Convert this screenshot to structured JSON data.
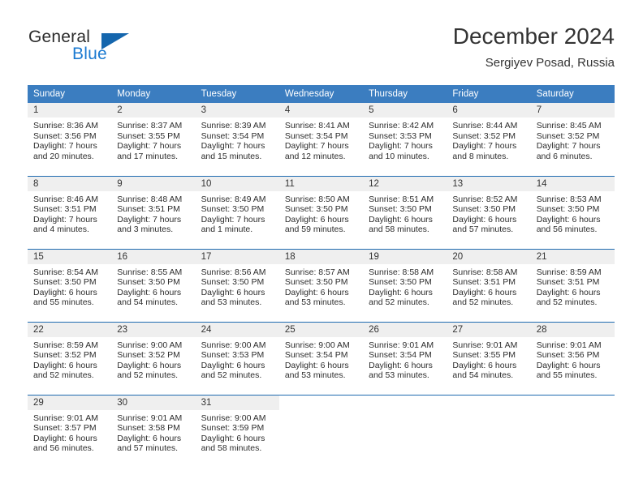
{
  "brand": {
    "name_part1": "General",
    "name_part2": "Blue",
    "accent_color": "#1b7ad1",
    "triangle_color": "#1566ad"
  },
  "header": {
    "title": "December 2024",
    "subtitle": "Sergiyev Posad, Russia"
  },
  "theme": {
    "header_row_bg": "#3b7dc0",
    "row_divider": "#1f6bb0",
    "daynum_bg": "#efefef"
  },
  "weekday_headers": [
    "Sunday",
    "Monday",
    "Tuesday",
    "Wednesday",
    "Thursday",
    "Friday",
    "Saturday"
  ],
  "weeks": [
    [
      {
        "day": "1",
        "sunrise": "Sunrise: 8:36 AM",
        "sunset": "Sunset: 3:56 PM",
        "daylight_line1": "Daylight: 7 hours",
        "daylight_line2": "and 20 minutes."
      },
      {
        "day": "2",
        "sunrise": "Sunrise: 8:37 AM",
        "sunset": "Sunset: 3:55 PM",
        "daylight_line1": "Daylight: 7 hours",
        "daylight_line2": "and 17 minutes."
      },
      {
        "day": "3",
        "sunrise": "Sunrise: 8:39 AM",
        "sunset": "Sunset: 3:54 PM",
        "daylight_line1": "Daylight: 7 hours",
        "daylight_line2": "and 15 minutes."
      },
      {
        "day": "4",
        "sunrise": "Sunrise: 8:41 AM",
        "sunset": "Sunset: 3:54 PM",
        "daylight_line1": "Daylight: 7 hours",
        "daylight_line2": "and 12 minutes."
      },
      {
        "day": "5",
        "sunrise": "Sunrise: 8:42 AM",
        "sunset": "Sunset: 3:53 PM",
        "daylight_line1": "Daylight: 7 hours",
        "daylight_line2": "and 10 minutes."
      },
      {
        "day": "6",
        "sunrise": "Sunrise: 8:44 AM",
        "sunset": "Sunset: 3:52 PM",
        "daylight_line1": "Daylight: 7 hours",
        "daylight_line2": "and 8 minutes."
      },
      {
        "day": "7",
        "sunrise": "Sunrise: 8:45 AM",
        "sunset": "Sunset: 3:52 PM",
        "daylight_line1": "Daylight: 7 hours",
        "daylight_line2": "and 6 minutes."
      }
    ],
    [
      {
        "day": "8",
        "sunrise": "Sunrise: 8:46 AM",
        "sunset": "Sunset: 3:51 PM",
        "daylight_line1": "Daylight: 7 hours",
        "daylight_line2": "and 4 minutes."
      },
      {
        "day": "9",
        "sunrise": "Sunrise: 8:48 AM",
        "sunset": "Sunset: 3:51 PM",
        "daylight_line1": "Daylight: 7 hours",
        "daylight_line2": "and 3 minutes."
      },
      {
        "day": "10",
        "sunrise": "Sunrise: 8:49 AM",
        "sunset": "Sunset: 3:50 PM",
        "daylight_line1": "Daylight: 7 hours",
        "daylight_line2": "and 1 minute."
      },
      {
        "day": "11",
        "sunrise": "Sunrise: 8:50 AM",
        "sunset": "Sunset: 3:50 PM",
        "daylight_line1": "Daylight: 6 hours",
        "daylight_line2": "and 59 minutes."
      },
      {
        "day": "12",
        "sunrise": "Sunrise: 8:51 AM",
        "sunset": "Sunset: 3:50 PM",
        "daylight_line1": "Daylight: 6 hours",
        "daylight_line2": "and 58 minutes."
      },
      {
        "day": "13",
        "sunrise": "Sunrise: 8:52 AM",
        "sunset": "Sunset: 3:50 PM",
        "daylight_line1": "Daylight: 6 hours",
        "daylight_line2": "and 57 minutes."
      },
      {
        "day": "14",
        "sunrise": "Sunrise: 8:53 AM",
        "sunset": "Sunset: 3:50 PM",
        "daylight_line1": "Daylight: 6 hours",
        "daylight_line2": "and 56 minutes."
      }
    ],
    [
      {
        "day": "15",
        "sunrise": "Sunrise: 8:54 AM",
        "sunset": "Sunset: 3:50 PM",
        "daylight_line1": "Daylight: 6 hours",
        "daylight_line2": "and 55 minutes."
      },
      {
        "day": "16",
        "sunrise": "Sunrise: 8:55 AM",
        "sunset": "Sunset: 3:50 PM",
        "daylight_line1": "Daylight: 6 hours",
        "daylight_line2": "and 54 minutes."
      },
      {
        "day": "17",
        "sunrise": "Sunrise: 8:56 AM",
        "sunset": "Sunset: 3:50 PM",
        "daylight_line1": "Daylight: 6 hours",
        "daylight_line2": "and 53 minutes."
      },
      {
        "day": "18",
        "sunrise": "Sunrise: 8:57 AM",
        "sunset": "Sunset: 3:50 PM",
        "daylight_line1": "Daylight: 6 hours",
        "daylight_line2": "and 53 minutes."
      },
      {
        "day": "19",
        "sunrise": "Sunrise: 8:58 AM",
        "sunset": "Sunset: 3:50 PM",
        "daylight_line1": "Daylight: 6 hours",
        "daylight_line2": "and 52 minutes."
      },
      {
        "day": "20",
        "sunrise": "Sunrise: 8:58 AM",
        "sunset": "Sunset: 3:51 PM",
        "daylight_line1": "Daylight: 6 hours",
        "daylight_line2": "and 52 minutes."
      },
      {
        "day": "21",
        "sunrise": "Sunrise: 8:59 AM",
        "sunset": "Sunset: 3:51 PM",
        "daylight_line1": "Daylight: 6 hours",
        "daylight_line2": "and 52 minutes."
      }
    ],
    [
      {
        "day": "22",
        "sunrise": "Sunrise: 8:59 AM",
        "sunset": "Sunset: 3:52 PM",
        "daylight_line1": "Daylight: 6 hours",
        "daylight_line2": "and 52 minutes."
      },
      {
        "day": "23",
        "sunrise": "Sunrise: 9:00 AM",
        "sunset": "Sunset: 3:52 PM",
        "daylight_line1": "Daylight: 6 hours",
        "daylight_line2": "and 52 minutes."
      },
      {
        "day": "24",
        "sunrise": "Sunrise: 9:00 AM",
        "sunset": "Sunset: 3:53 PM",
        "daylight_line1": "Daylight: 6 hours",
        "daylight_line2": "and 52 minutes."
      },
      {
        "day": "25",
        "sunrise": "Sunrise: 9:00 AM",
        "sunset": "Sunset: 3:54 PM",
        "daylight_line1": "Daylight: 6 hours",
        "daylight_line2": "and 53 minutes."
      },
      {
        "day": "26",
        "sunrise": "Sunrise: 9:01 AM",
        "sunset": "Sunset: 3:54 PM",
        "daylight_line1": "Daylight: 6 hours",
        "daylight_line2": "and 53 minutes."
      },
      {
        "day": "27",
        "sunrise": "Sunrise: 9:01 AM",
        "sunset": "Sunset: 3:55 PM",
        "daylight_line1": "Daylight: 6 hours",
        "daylight_line2": "and 54 minutes."
      },
      {
        "day": "28",
        "sunrise": "Sunrise: 9:01 AM",
        "sunset": "Sunset: 3:56 PM",
        "daylight_line1": "Daylight: 6 hours",
        "daylight_line2": "and 55 minutes."
      }
    ],
    [
      {
        "day": "29",
        "sunrise": "Sunrise: 9:01 AM",
        "sunset": "Sunset: 3:57 PM",
        "daylight_line1": "Daylight: 6 hours",
        "daylight_line2": "and 56 minutes."
      },
      {
        "day": "30",
        "sunrise": "Sunrise: 9:01 AM",
        "sunset": "Sunset: 3:58 PM",
        "daylight_line1": "Daylight: 6 hours",
        "daylight_line2": "and 57 minutes."
      },
      {
        "day": "31",
        "sunrise": "Sunrise: 9:00 AM",
        "sunset": "Sunset: 3:59 PM",
        "daylight_line1": "Daylight: 6 hours",
        "daylight_line2": "and 58 minutes."
      },
      {
        "day": "",
        "sunrise": "",
        "sunset": "",
        "daylight_line1": "",
        "daylight_line2": ""
      },
      {
        "day": "",
        "sunrise": "",
        "sunset": "",
        "daylight_line1": "",
        "daylight_line2": ""
      },
      {
        "day": "",
        "sunrise": "",
        "sunset": "",
        "daylight_line1": "",
        "daylight_line2": ""
      },
      {
        "day": "",
        "sunrise": "",
        "sunset": "",
        "daylight_line1": "",
        "daylight_line2": ""
      }
    ]
  ]
}
